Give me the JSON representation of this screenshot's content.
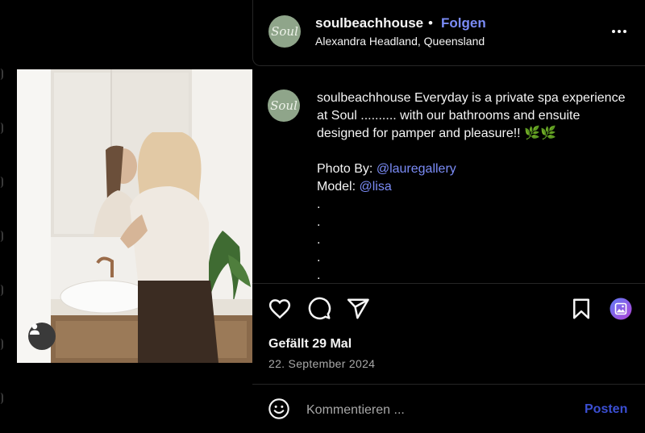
{
  "post": {
    "username": "soulbeachhouse",
    "separator": "•",
    "follow_label": "Folgen",
    "location": "Alexandra Headland, Queensland",
    "avatar_text": "Soul"
  },
  "caption": {
    "username": "soulbeachhouse",
    "text": "Everyday is a private spa experience at Soul .......... with our bathrooms and ensuite designed for pamper and pleasure!! 🌿🌿",
    "photo_by_label": "Photo By:",
    "photo_by_mention": "@lauregallery",
    "model_label": "Model:",
    "model_mention": "@lisa",
    "dots": [
      ".",
      ".",
      ".",
      ".",
      "."
    ]
  },
  "stats": {
    "likes": "Gefällt 29 Mal",
    "date": "22. September 2024"
  },
  "comment": {
    "placeholder": "Kommentieren ...",
    "post_label": "Posten"
  },
  "icons": {
    "like": "heart-icon",
    "comment": "comment-icon",
    "share": "paper-plane-icon",
    "save": "bookmark-icon",
    "media": "image-gallery-icon",
    "emoji": "smiley-icon",
    "more": "more-options-icon",
    "tag": "user-tag-icon"
  },
  "colors": {
    "accent_link": "#7b8cf7",
    "post_button": "#3b4fd3",
    "avatar_bg": "#8fa58a",
    "background": "#000000"
  }
}
